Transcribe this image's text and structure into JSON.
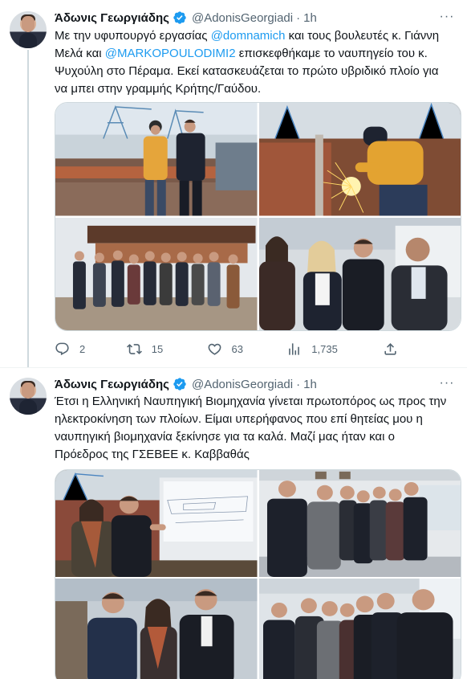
{
  "tweets": [
    {
      "author_name": "Άδωνις Γεωργιάδης",
      "handle": "@AdonisGeorgiadi",
      "separator": "·",
      "time": "1h",
      "text_segments": [
        {
          "t": "Με την υφυπουργό εργασίας ",
          "mention": false
        },
        {
          "t": "@domnamich",
          "mention": true
        },
        {
          "t": " και τους βουλευτές κ. Γιάννη\nΜελά και ",
          "mention": false
        },
        {
          "t": "@MARKOPOULODIMI2",
          "mention": true
        },
        {
          "t": " επισκεφθήκαμε το ναυπηγείο του κ.\nΨυχούλη στο Πέραμα. Εκεί κατασκευάζεται το πρώτο υβριδικό πλοίο για\nνα μπει στην γραμμής Κρήτης/Γαύδου.",
          "mention": false
        }
      ],
      "photos": [
        "shipyard-two-men",
        "welder-sparks",
        "group-at-ship-hull",
        "four-people-smiling"
      ],
      "actions": {
        "replies": "2",
        "retweets": "15",
        "likes": "63",
        "views": "1,735"
      }
    },
    {
      "author_name": "Άδωνις Γεωργιάδης",
      "handle": "@AdonisGeorgiadi",
      "separator": "·",
      "time": "1h",
      "text_segments": [
        {
          "t": "Έτσι η Ελληνική Ναυπηγική Βιομηχανία γίνεται πρωτοπόρος ως προς την\nηλεκτροκίνηση των πλοίων. Είμαι υπερήφανος που επί θητείας μου η\nναυπηγική βιομηχανία ξεκίνησε για τα καλά. Μαζί μας ήταν και ο\nΠρόεδρος της ΓΣΕΒΕΕ κ. Καββαθάς",
          "mention": false
        }
      ],
      "photos": [
        "blueprint-presentation",
        "office-group",
        "three-people-closeup",
        "office-group-closeup"
      ]
    }
  ],
  "colors": {
    "accent": "#1d9bf0",
    "secondary_text": "#536471",
    "border": "#cfd9de"
  },
  "icons": {
    "verified": "verified-badge-icon",
    "more": "more-dots-icon",
    "reply": "reply-icon",
    "retweet": "retweet-icon",
    "like": "heart-icon",
    "views": "views-chart-icon",
    "share": "share-icon"
  }
}
